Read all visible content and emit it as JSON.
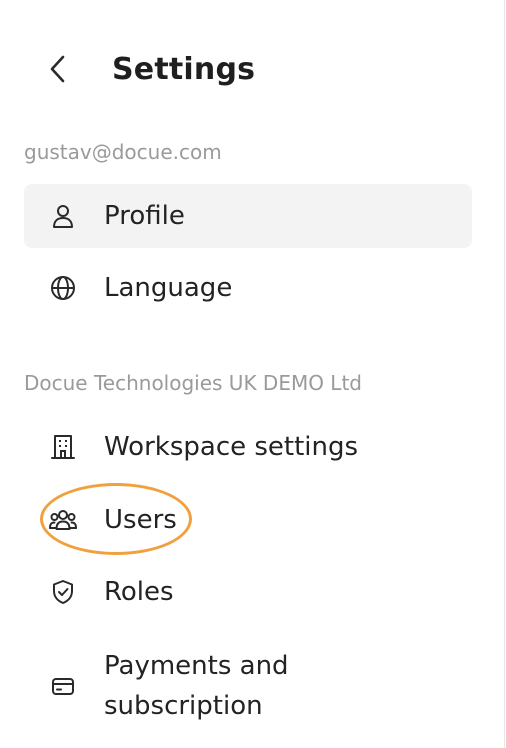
{
  "header": {
    "title": "Settings",
    "back_icon": "chevron-left-icon"
  },
  "account": {
    "email": "gustav@docue.com",
    "items": [
      {
        "label": "Profile",
        "icon": "user-icon",
        "active": true
      },
      {
        "label": "Language",
        "icon": "globe-icon",
        "active": false
      }
    ]
  },
  "workspace": {
    "name": "Docue Technologies UK DEMO Ltd",
    "items": [
      {
        "label": "Workspace settings",
        "icon": "building-icon"
      },
      {
        "label": "Users",
        "icon": "users-icon",
        "highlighted": true
      },
      {
        "label": "Roles",
        "icon": "shield-check-icon"
      },
      {
        "label": "Payments and subscription",
        "icon": "credit-card-icon"
      }
    ]
  },
  "colors": {
    "highlight_ring": "#f0a03c",
    "active_bg": "#f3f3f3",
    "muted_text": "#9a9a9a"
  }
}
